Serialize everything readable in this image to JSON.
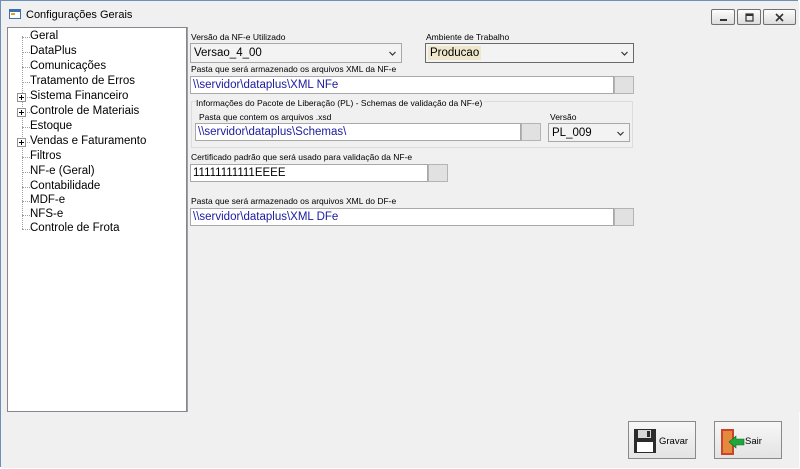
{
  "window": {
    "title": "Configurações Gerais",
    "icon": "app-window-icon",
    "controls": [
      "minimize-icon",
      "maximize-icon",
      "close-icon"
    ]
  },
  "tree": {
    "items": [
      {
        "label": "Geral",
        "expandable": false
      },
      {
        "label": "DataPlus",
        "expandable": false
      },
      {
        "label": "Comunicações",
        "expandable": false
      },
      {
        "label": "Tratamento de Erros",
        "expandable": false
      },
      {
        "label": "Sistema Financeiro",
        "expandable": true
      },
      {
        "label": "Controle de Materiais",
        "expandable": true
      },
      {
        "label": "Estoque",
        "expandable": false
      },
      {
        "label": "Vendas e Faturamento",
        "expandable": true
      },
      {
        "label": "Filtros",
        "expandable": false
      },
      {
        "label": "NF-e (Geral)",
        "expandable": false
      },
      {
        "label": "Contabilidade",
        "expandable": false
      },
      {
        "label": "MDF-e",
        "expandable": false
      },
      {
        "label": "NFS-e",
        "expandable": false
      },
      {
        "label": "Controle de Frota",
        "expandable": false
      }
    ]
  },
  "form": {
    "versao_label": "Versão da NF-e Utilizado",
    "versao_value": "Versao_4_00",
    "ambiente_label": "Ambiente de Trabalho",
    "ambiente_value": "Producao",
    "pasta_nfe_label": "Pasta que será armazenado os arquivos XML da NF-e",
    "pasta_nfe_value": "\\\\servidor\\dataplus\\XML NFe",
    "group_label": "Informações do Pacote de Liberação (PL) - Schemas de validação da NF-e)",
    "pasta_xsd_label": "Pasta que contem os arquivos .xsd",
    "pasta_xsd_value": "\\\\servidor\\dataplus\\Schemas\\",
    "versao_pl_label": "Versão",
    "versao_pl_value": "PL_009",
    "certificado_label": "Certificado padrão que será usado para validação da NF-e",
    "certificado_value": "11111111111EEEE",
    "pasta_dfe_label": "Pasta que será armazenado os arquivos XML do DF-e",
    "pasta_dfe_value": "\\\\servidor\\dataplus\\XML DFe"
  },
  "footer": {
    "gravar_label": "Gravar",
    "gravar_icon": "floppy-disk-icon",
    "sair_label": "Sair",
    "sair_icon": "exit-door-icon"
  },
  "colors": {
    "accent_value_text": "#1a1aa0",
    "focus_highlight": "#efe7cb"
  }
}
